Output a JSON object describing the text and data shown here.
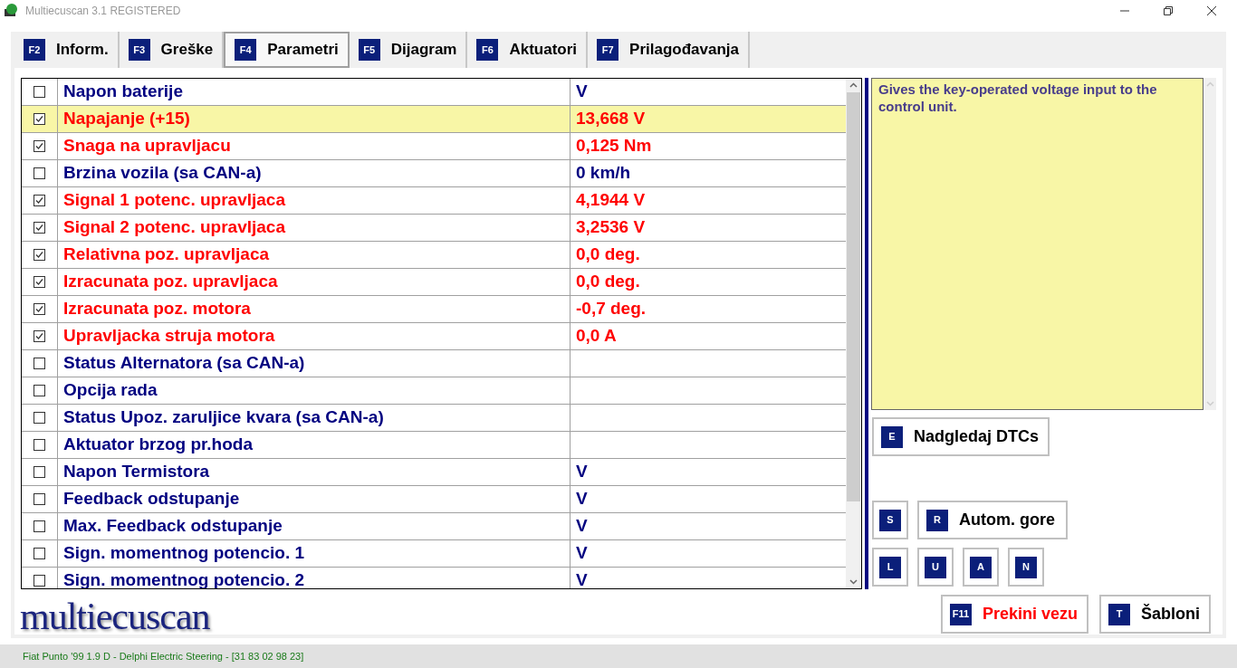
{
  "window": {
    "title": "Multiecuscan 3.1 REGISTERED"
  },
  "tabs": [
    {
      "key": "F2",
      "label": "Inform.",
      "selected": false
    },
    {
      "key": "F3",
      "label": "Greške",
      "selected": false
    },
    {
      "key": "F4",
      "label": "Parametri",
      "selected": true
    },
    {
      "key": "F5",
      "label": "Dijagram",
      "selected": false
    },
    {
      "key": "F6",
      "label": "Aktuatori",
      "selected": false
    },
    {
      "key": "F7",
      "label": "Prilagođavanja",
      "selected": false
    }
  ],
  "parameters": [
    {
      "name": "Napon baterije",
      "value": "V",
      "checked": false,
      "selected": false
    },
    {
      "name": "Napajanje (+15)",
      "value": "13,668 V",
      "checked": true,
      "selected": true
    },
    {
      "name": "Snaga na upravljacu",
      "value": "0,125 Nm",
      "checked": true,
      "selected": false
    },
    {
      "name": "Brzina vozila (sa CAN-a)",
      "value": "0 km/h",
      "checked": false,
      "selected": false
    },
    {
      "name": "Signal 1 potenc. upravljaca",
      "value": "4,1944 V",
      "checked": true,
      "selected": false
    },
    {
      "name": "Signal 2 potenc. upravljaca",
      "value": "3,2536 V",
      "checked": true,
      "selected": false
    },
    {
      "name": "Relativna poz. upravljaca",
      "value": "0,0 deg.",
      "checked": true,
      "selected": false
    },
    {
      "name": "Izracunata poz. upravljaca",
      "value": "0,0 deg.",
      "checked": true,
      "selected": false
    },
    {
      "name": "Izracunata poz. motora",
      "value": "-0,7 deg.",
      "checked": true,
      "selected": false
    },
    {
      "name": "Upravljacka struja motora",
      "value": "0,0 A",
      "checked": true,
      "selected": false
    },
    {
      "name": "Status Alternatora (sa CAN-a)",
      "checked": false,
      "selected": false
    },
    {
      "name": "Opcija rada",
      "checked": false,
      "selected": false
    },
    {
      "name": "Status Upoz. zaruljice kvara (sa CAN-a)",
      "checked": false,
      "selected": false
    },
    {
      "name": "Aktuator brzog pr.hoda",
      "checked": false,
      "selected": false
    },
    {
      "name": "Napon Termistora",
      "value": "V",
      "checked": false,
      "selected": false
    },
    {
      "name": "Feedback odstupanje",
      "value": "V",
      "checked": false,
      "selected": false
    },
    {
      "name": "Max. Feedback odstupanje",
      "value": "V",
      "checked": false,
      "selected": false
    },
    {
      "name": "Sign. momentnog potencio. 1",
      "value": "V",
      "checked": false,
      "selected": false
    },
    {
      "name": "Sign. momentnog potencio. 2",
      "value": "V",
      "checked": false,
      "selected": false
    }
  ],
  "description": "Gives the key-operated voltage input to the control unit.",
  "monitor_button": {
    "key": "E",
    "label": "Nadgledaj DTCs"
  },
  "scroll_buttons": [
    {
      "key": "S"
    },
    {
      "key": "R",
      "label": "Autom. gore"
    }
  ],
  "key_buttons": [
    {
      "key": "L"
    },
    {
      "key": "U"
    },
    {
      "key": "A"
    },
    {
      "key": "N"
    }
  ],
  "bottom_buttons": [
    {
      "key": "F11",
      "label": "Prekini vezu",
      "kind": "danger"
    },
    {
      "key": "T",
      "label": "Šabloni",
      "kind": "normal"
    }
  ],
  "logo": "multiecuscan",
  "status_bar": "Fiat Punto '99 1.9 D - Delphi Electric Steering - [31 83 02 98 23]"
}
